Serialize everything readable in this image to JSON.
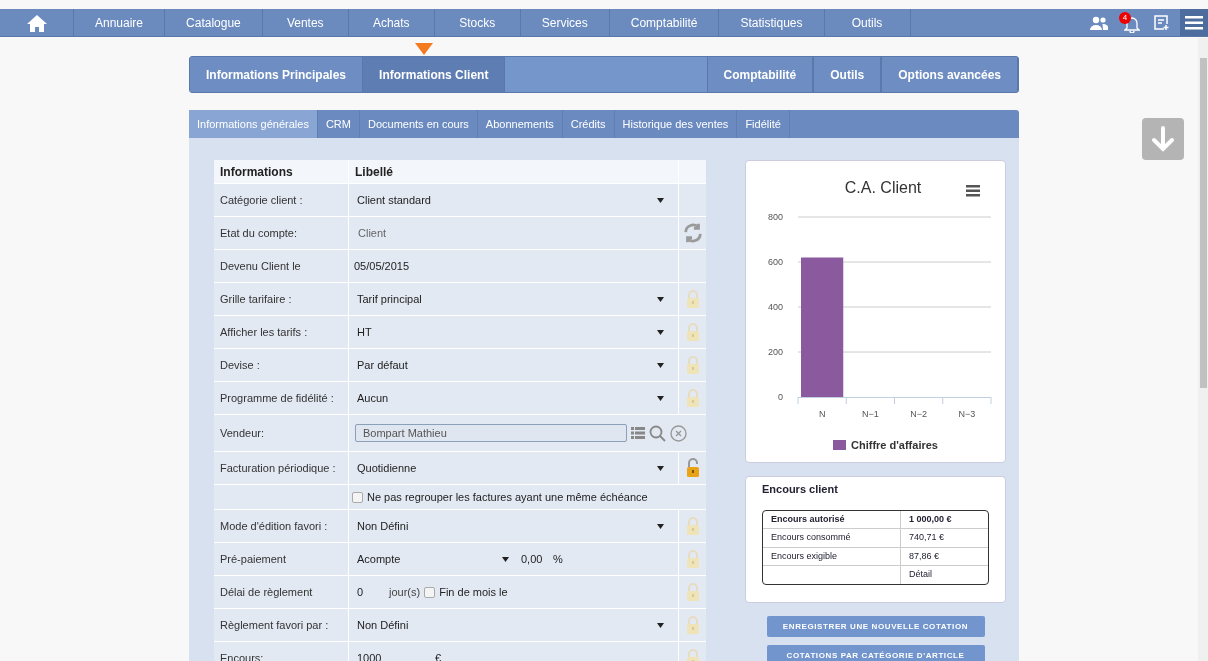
{
  "nav": {
    "items": [
      "Annuaire",
      "Catalogue",
      "Ventes",
      "Achats",
      "Stocks",
      "Services",
      "Comptabilité",
      "Statistiques",
      "Outils"
    ],
    "notification_count": "4"
  },
  "main_tabs": {
    "left": [
      {
        "label": "Informations Principales",
        "selected": false
      },
      {
        "label": "Informations Client",
        "selected": true
      }
    ],
    "right": [
      {
        "label": "Comptabilité",
        "selected": false
      },
      {
        "label": "Outils",
        "selected": false
      },
      {
        "label": "Options avancées",
        "selected": false
      }
    ]
  },
  "sub_tabs": [
    {
      "label": "Informations générales",
      "selected": true
    },
    {
      "label": "CRM",
      "selected": false
    },
    {
      "label": "Documents en cours",
      "selected": false
    },
    {
      "label": "Abonnements",
      "selected": false
    },
    {
      "label": "Crédits",
      "selected": false
    },
    {
      "label": "Historique des ventes",
      "selected": false
    },
    {
      "label": "Fidélité",
      "selected": false
    }
  ],
  "form": {
    "columns": [
      "Informations",
      "Libellé"
    ],
    "rows": [
      {
        "kind": "select",
        "label": "Catégorie client :",
        "value": "Client standard"
      },
      {
        "kind": "text",
        "label": "Etat du compte:",
        "value": "Client",
        "refresh": true
      },
      {
        "kind": "date",
        "label": "Devenu Client le",
        "value": "05/05/2015"
      },
      {
        "kind": "select",
        "label": "Grille tarifaire :",
        "value": "Tarif principal",
        "locked": true
      },
      {
        "kind": "select",
        "label": "Afficher les tarifs :",
        "value": "HT",
        "locked": true
      },
      {
        "kind": "select",
        "label": "Devise :",
        "value": "Par défaut",
        "locked": true
      },
      {
        "kind": "select",
        "label": "Programme de fidélité :",
        "value": "Aucun",
        "locked": true
      },
      {
        "kind": "vendor",
        "label": "Vendeur:",
        "value": "Bompart Mathieu"
      },
      {
        "kind": "select",
        "label": "Facturation périodique :",
        "value": "Quotidienne",
        "locked": false
      },
      {
        "kind": "checkbox",
        "check_label": "Ne pas regrouper les factures ayant une même échéance",
        "checked": false
      },
      {
        "kind": "select",
        "label": "Mode d'édition favori :",
        "value": "Non Défini",
        "locked": true
      },
      {
        "kind": "prepay",
        "label": "Pré-paiement",
        "value": "Acompte",
        "amount": "0,00",
        "unit": "%",
        "locked": true
      },
      {
        "kind": "delay",
        "label": "Délai de règlement",
        "value": "0",
        "days_label": "jour(s)",
        "check_label": "Fin de mois le",
        "checked": false,
        "locked": true
      },
      {
        "kind": "select",
        "label": "Règlement favori par :",
        "value": "Non Défini",
        "locked": true
      },
      {
        "kind": "amount",
        "label": "Encours:",
        "value": "1000",
        "unit": "€",
        "locked": true
      }
    ]
  },
  "chart_card": {
    "chart_data": {
      "type": "bar",
      "title": "C.A. Client",
      "categories": [
        "N",
        "N−1",
        "N−2",
        "N−3"
      ],
      "series": [
        {
          "name": "Chiffre d'affaires",
          "color": "#8b5a9e",
          "values": [
            620,
            0,
            0,
            0
          ]
        }
      ],
      "ylim": [
        0,
        800
      ],
      "yticks": [
        0,
        200,
        400,
        600,
        800
      ],
      "grid": true
    }
  },
  "encours": {
    "title": "Encours client",
    "rows": [
      {
        "label": "Encours autorisé",
        "value": "1 000,00 €",
        "bold": true
      },
      {
        "label": "Encours consommé",
        "value": "740,71 €",
        "bold": false
      },
      {
        "label": "Encours exigible",
        "value": "87,86 €",
        "bold": false
      },
      {
        "label": "",
        "value": "Détail",
        "bold": false
      }
    ]
  },
  "buttons": [
    "ENREGISTRER UNE NOUVELLE COTATION",
    "COTATIONS PAR CATÉGORIE D'ARTICLE"
  ]
}
